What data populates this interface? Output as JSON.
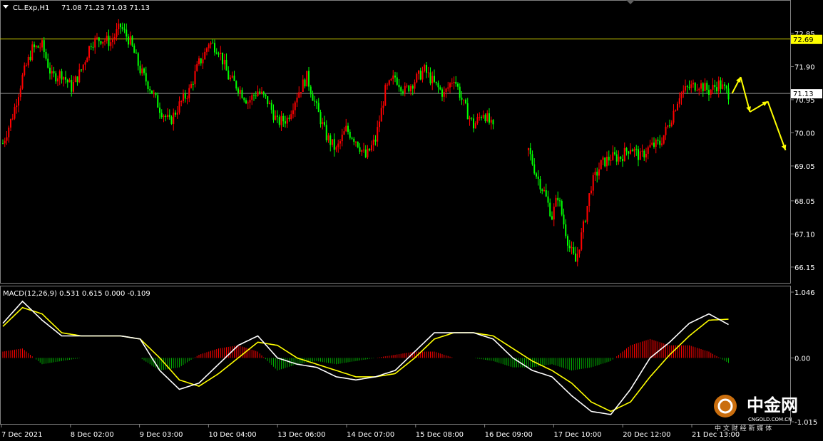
{
  "header": {
    "symbol_label": "CL.Exp,H1",
    "ohlc_label": "71.08 71.23 71.03 71.13"
  },
  "macd_header": {
    "label": "MACD(12,26,9) 0.531 0.615 0.000 -0.109"
  },
  "levels": {
    "resistance": {
      "value": 72.69,
      "label": "72.69"
    },
    "current": {
      "value": 71.13,
      "label": "71.13"
    }
  },
  "watermark": {
    "brand": "中金网",
    "site": "CNGOLD.COM.CN",
    "slogan": "中 文 财 经 新 媒 体"
  },
  "colors": {
    "bull": "#00ff00",
    "bear": "#ff0000",
    "macd_line": "#ffffff",
    "signal_line": "#ffff00",
    "hist_pos": "#ff0000",
    "hist_neg": "#00aa00",
    "grid_line": "#808080",
    "level_line": "#c0c000",
    "arrow": "#ffff00"
  },
  "chart_data": [
    {
      "type": "candlestick",
      "title": "CL.Exp,H1",
      "ylim": [
        65.8,
        73.4
      ],
      "yticks": [
        "72.85",
        "71.90",
        "70.95",
        "70.00",
        "69.05",
        "68.05",
        "67.10",
        "66.15"
      ],
      "ytick_values": [
        72.85,
        71.9,
        70.95,
        70.0,
        69.05,
        68.05,
        67.1,
        66.15
      ],
      "xticks": [
        "7 Dec 2021",
        "8 Dec 02:00",
        "9 Dec 03:00",
        "10 Dec 04:00",
        "13 Dec 06:00",
        "14 Dec 07:00",
        "15 Dec 08:00",
        "16 Dec 09:00",
        "17 Dec 10:00",
        "20 Dec 12:00",
        "21 Dec 13:00"
      ],
      "last_ohlc": {
        "open": 71.08,
        "high": 71.23,
        "low": 71.03,
        "close": 71.13
      },
      "horizontal_lines": [
        72.69,
        71.13
      ],
      "close_path": {
        "x": [
          0,
          5,
          10,
          15,
          20,
          25,
          30,
          35,
          40,
          45,
          50,
          55,
          60,
          65,
          70,
          75,
          80,
          85,
          90,
          95,
          100,
          102.5,
          105,
          110,
          115,
          120,
          125,
          130,
          135,
          140,
          145,
          150,
          155,
          160,
          165,
          170,
          175,
          180,
          185,
          190,
          195,
          200,
          205,
          210,
          215,
          220,
          225,
          230,
          235,
          240,
          245,
          250
        ],
        "y": [
          69.7,
          70.5,
          71.6,
          72.4,
          72.5,
          71.6,
          71.7,
          71.3,
          71.8,
          72.6,
          72.7,
          72.6,
          73.05,
          72.6,
          71.8,
          71.3,
          70.7,
          70.3,
          70.8,
          71.2,
          72.0,
          72.2,
          72.6,
          72.4,
          71.6,
          71.3,
          70.9,
          71.2,
          70.9,
          70.3,
          70.4,
          71.1,
          71.6,
          70.7,
          69.9,
          69.5,
          70.1,
          69.8,
          69.3,
          69.8,
          71.2,
          71.6,
          71.2,
          71.5,
          71.8,
          71.4,
          71.1,
          71.6,
          70.8,
          70.2,
          70.6,
          70.1
        ]
      },
      "close_path_tail": {
        "x": [
          268,
          272,
          276,
          280,
          283,
          286,
          289,
          292,
          296,
          300,
          305,
          310,
          315,
          320,
          325,
          330,
          335,
          340,
          345,
          350,
          355,
          360,
          365,
          370
        ],
        "y": [
          69.5,
          68.8,
          68.3,
          67.6,
          68.2,
          67.4,
          66.7,
          66.3,
          67.3,
          68.5,
          69.1,
          69.3,
          69.3,
          69.6,
          69.3,
          69.6,
          69.7,
          70.3,
          71.1,
          71.3,
          71.4,
          71.2,
          71.4,
          71.13
        ]
      },
      "projection_arrows": [
        {
          "from": [
            71.13
          ],
          "points": [
            [
              71.13,
              71.6
            ],
            [
              71.6,
              70.6
            ],
            [
              70.6,
              70.9
            ],
            [
              70.9,
              69.5
            ]
          ]
        }
      ]
    },
    {
      "type": "macd",
      "title": "MACD(12,26,9)",
      "values": {
        "macd": 0.531,
        "signal": 0.615,
        "hist": 0.0,
        "extra": -0.109
      },
      "ylim": [
        -1.015,
        1.046
      ],
      "yticks": [
        "1.046",
        "0.00",
        "-1.015"
      ],
      "ytick_values": [
        1.046,
        0.0,
        -1.015
      ],
      "series": [
        {
          "name": "MACD",
          "x": [
            0,
            10,
            20,
            30,
            40,
            50,
            60,
            70,
            80,
            90,
            100,
            110,
            120,
            130,
            140,
            150,
            160,
            170,
            180,
            190,
            200,
            210,
            220,
            230,
            240,
            250,
            260,
            270,
            280,
            290,
            300,
            310,
            320,
            330,
            340,
            350,
            360,
            370
          ],
          "y": [
            0.55,
            0.9,
            0.6,
            0.35,
            0.35,
            0.35,
            0.35,
            0.3,
            -0.2,
            -0.5,
            -0.4,
            -0.1,
            0.2,
            0.35,
            0.0,
            -0.1,
            -0.15,
            -0.3,
            -0.35,
            -0.3,
            -0.2,
            0.1,
            0.4,
            0.4,
            0.4,
            0.3,
            0.0,
            -0.2,
            -0.3,
            -0.6,
            -0.85,
            -0.9,
            -0.5,
            0.0,
            0.25,
            0.55,
            0.7,
            0.53
          ]
        },
        {
          "name": "Signal",
          "x": [
            0,
            10,
            20,
            30,
            40,
            50,
            60,
            70,
            80,
            90,
            100,
            110,
            120,
            130,
            140,
            150,
            160,
            170,
            180,
            190,
            200,
            210,
            220,
            230,
            240,
            250,
            260,
            270,
            280,
            290,
            300,
            310,
            320,
            330,
            340,
            350,
            360,
            370
          ],
          "y": [
            0.5,
            0.8,
            0.7,
            0.4,
            0.35,
            0.35,
            0.35,
            0.3,
            0.0,
            -0.35,
            -0.45,
            -0.25,
            0.0,
            0.25,
            0.2,
            0.0,
            -0.1,
            -0.2,
            -0.3,
            -0.3,
            -0.25,
            0.0,
            0.3,
            0.4,
            0.4,
            0.35,
            0.15,
            -0.05,
            -0.2,
            -0.4,
            -0.7,
            -0.85,
            -0.7,
            -0.3,
            0.05,
            0.35,
            0.6,
            0.615
          ]
        },
        {
          "name": "Histogram",
          "x": [
            0,
            10,
            20,
            30,
            40,
            50,
            60,
            70,
            80,
            90,
            100,
            110,
            120,
            130,
            140,
            150,
            160,
            170,
            180,
            190,
            200,
            210,
            220,
            230,
            240,
            250,
            260,
            270,
            280,
            290,
            300,
            310,
            320,
            330,
            340,
            350,
            360,
            370
          ],
          "y": [
            0.1,
            0.15,
            -0.1,
            -0.05,
            0.0,
            0.0,
            0.0,
            0.0,
            -0.2,
            -0.15,
            0.05,
            0.15,
            0.2,
            0.1,
            -0.2,
            -0.1,
            -0.05,
            -0.1,
            -0.05,
            0.0,
            0.05,
            0.1,
            0.1,
            0.0,
            0.0,
            -0.05,
            -0.15,
            -0.15,
            -0.1,
            -0.2,
            -0.15,
            -0.05,
            0.2,
            0.3,
            0.2,
            0.2,
            0.1,
            -0.08
          ]
        }
      ]
    }
  ]
}
